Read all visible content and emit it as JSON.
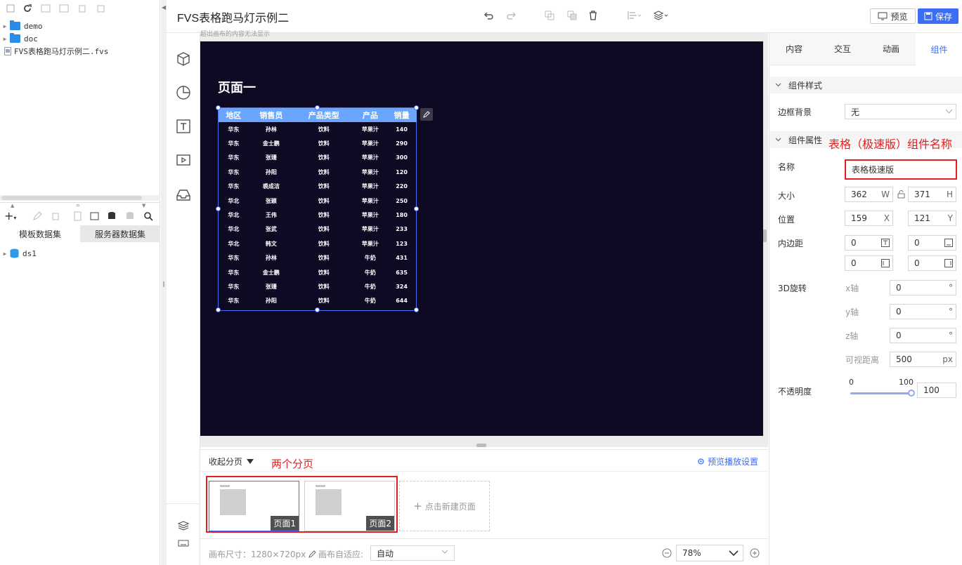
{
  "left_panel": {
    "tree": [
      {
        "label": "demo",
        "type": "folder"
      },
      {
        "label": "doc",
        "type": "folder"
      },
      {
        "label": "FVS表格跑马灯示例二.fvs",
        "type": "file"
      }
    ],
    "dataset_tabs": [
      "模板数据集",
      "服务器数据集"
    ],
    "datasets": [
      {
        "label": "ds1"
      }
    ]
  },
  "topbar": {
    "title": "FVS表格跑马灯示例二",
    "preview_label": "预览",
    "save_label": "保存"
  },
  "canvas": {
    "hint": "超出画布的内容无法显示",
    "page_title": "页面一",
    "table": {
      "headers": [
        "地区",
        "销售员",
        "产品类型",
        "产品",
        "销量"
      ],
      "rows": [
        [
          "华东",
          "孙林",
          "饮料",
          "苹果汁",
          "140"
        ],
        [
          "华东",
          "金士鹏",
          "饮料",
          "苹果汁",
          "290"
        ],
        [
          "华东",
          "张珊",
          "饮料",
          "苹果汁",
          "300"
        ],
        [
          "华东",
          "孙阳",
          "饮料",
          "苹果汁",
          "120"
        ],
        [
          "华东",
          "裘成洁",
          "饮料",
          "苹果汁",
          "220"
        ],
        [
          "华北",
          "张颖",
          "饮料",
          "苹果汁",
          "250"
        ],
        [
          "华北",
          "王伟",
          "饮料",
          "苹果汁",
          "180"
        ],
        [
          "华北",
          "张武",
          "饮料",
          "苹果汁",
          "233"
        ],
        [
          "华北",
          "韩文",
          "饮料",
          "苹果汁",
          "123"
        ],
        [
          "华东",
          "孙林",
          "饮料",
          "牛奶",
          "431"
        ],
        [
          "华东",
          "金士鹏",
          "饮料",
          "牛奶",
          "635"
        ],
        [
          "华东",
          "张珊",
          "饮料",
          "牛奶",
          "324"
        ],
        [
          "华东",
          "孙阳",
          "饮料",
          "牛奶",
          "644"
        ]
      ],
      "header_color": "#6aa6ff"
    }
  },
  "pages": {
    "collapse_label": "收起分页",
    "annotation": "两个分页",
    "preview_settings": "预览播放设置",
    "items": [
      "页面1",
      "页面2"
    ],
    "new_page": "点击新建页面"
  },
  "statusbar": {
    "canvas_size": "画布尺寸：1280×720px",
    "adapt_label": "画布自适应:",
    "adapt_value": "自动",
    "zoom": "78%"
  },
  "right_panel": {
    "tabs": [
      "内容",
      "交互",
      "动画",
      "组件"
    ],
    "active_tab": "组件",
    "style_section": "组件样式",
    "border_bg_label": "边框背景",
    "border_bg_value": "无",
    "props_section": "组件属性",
    "annotation": "表格（极速版）组件名称",
    "name_label": "名称",
    "name_value": "表格极速版",
    "size_label": "大小",
    "width": "362",
    "width_unit": "W",
    "height": "371",
    "height_unit": "H",
    "position_label": "位置",
    "pos_x": "159",
    "pos_x_unit": "X",
    "pos_y": "121",
    "pos_y_unit": "Y",
    "padding_label": "内边距",
    "padding": [
      "0",
      "0",
      "0",
      "0"
    ],
    "rotate_label": "3D旋转",
    "x_axis": "x轴",
    "x_value": "0",
    "y_axis": "y轴",
    "y_value": "0",
    "z_axis": "z轴",
    "z_value": "0",
    "degree": "°",
    "view_distance_label": "可视距离",
    "view_distance": "500",
    "px": "px",
    "opacity_label": "不透明度",
    "opacity_min": "0",
    "opacity_max": "100",
    "opacity_value": "100",
    "opacity_level": 1.0
  },
  "colors": {
    "accent": "#3d6df2",
    "annotation_red": "#e02020",
    "canvas_bg": "#0f0a24"
  }
}
